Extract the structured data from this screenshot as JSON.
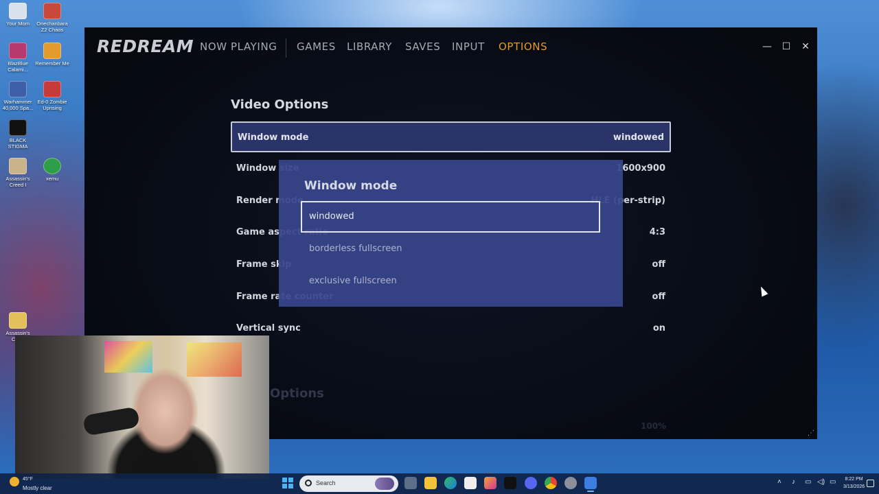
{
  "desktop_icons": [
    {
      "label": "Your Mom",
      "color": "#d9e2ec"
    },
    {
      "label": "Onechanbara Z2 Chaos",
      "color": "#c8483b"
    },
    {
      "label": "BlazBlue Calami...",
      "color": "#b63a6e"
    },
    {
      "label": "Remember Me",
      "color": "#e59a2e"
    },
    {
      "label": "Warhammer 40,000 Spa...",
      "color": "#3e5fa8"
    },
    {
      "label": "Ed-0 Zombie Uprising",
      "color": "#c73a3a"
    },
    {
      "label": "BLACK STIGMA",
      "color": "#111111"
    },
    {
      "label": "Assassin's Creed I",
      "color": "#c8b38a"
    },
    {
      "label": "xemu",
      "color": "#2f9e48"
    },
    {
      "label": "Assassin's Cre...",
      "color": "#e3c05a"
    }
  ],
  "app": {
    "logo": "REDREAM",
    "nav": {
      "now_playing": "NOW PLAYING",
      "games": "GAMES",
      "library": "LIBRARY",
      "saves": "SAVES",
      "input": "INPUT",
      "options": "OPTIONS"
    },
    "window_controls": {
      "minimize": "—",
      "maximize": "☐",
      "close": "✕"
    },
    "section_title": "Video Options",
    "section_title_2": "Options",
    "faded_value": "100%",
    "options": [
      {
        "label": "Window mode",
        "value": "windowed"
      },
      {
        "label": "Window size",
        "value": "1600x900"
      },
      {
        "label": "Render mode",
        "value": "HLE (per-strip)"
      },
      {
        "label": "Game aspect ratio",
        "value": "4:3"
      },
      {
        "label": "Frame skip",
        "value": "off"
      },
      {
        "label": "Frame rate counter",
        "value": "off"
      },
      {
        "label": "Vertical sync",
        "value": "on"
      }
    ],
    "popup": {
      "title": "Window mode",
      "choices": [
        "windowed",
        "borderless fullscreen",
        "exclusive fullscreen"
      ],
      "selected": "windowed"
    },
    "accent_color": "#e79a1f"
  },
  "taskbar": {
    "weather_temp": "45°F",
    "weather_text": "Mostly clear",
    "search_placeholder": "Search",
    "time": "8:22 PM",
    "date": "3/13/2026"
  }
}
